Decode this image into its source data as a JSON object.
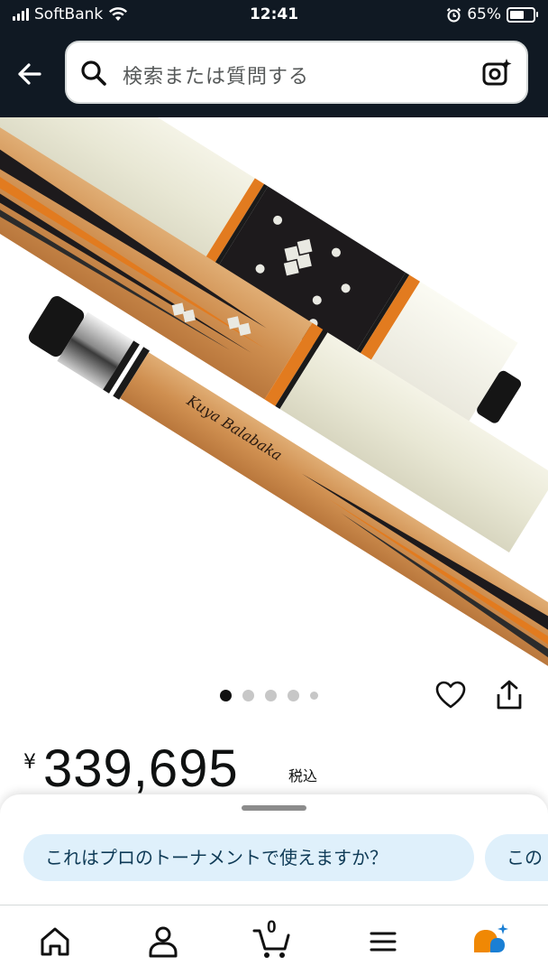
{
  "status_bar": {
    "carrier": "SoftBank",
    "time": "12:41",
    "battery": "65%"
  },
  "header": {
    "search_placeholder": "検索または質問する",
    "background_color": "#101923"
  },
  "product": {
    "image_alt": "billiard cue product image",
    "carousel": {
      "total": 5,
      "active_index": 0
    }
  },
  "price": {
    "currency_symbol": "¥",
    "value": "339,695",
    "tax_label": "税込"
  },
  "suggestions": [
    {
      "label": "これはプロのトーナメントで使えますか？"
    },
    {
      "label": "この"
    }
  ],
  "bottom_nav": {
    "cart_count": "0",
    "items": [
      "home-icon",
      "account-icon",
      "cart-icon",
      "menu-icon",
      "rufus-icon"
    ]
  },
  "colors": {
    "accent_chip_bg": "#dff0fb",
    "rufus_orange": "#f08804",
    "rufus_blue": "#1a7fd4"
  }
}
